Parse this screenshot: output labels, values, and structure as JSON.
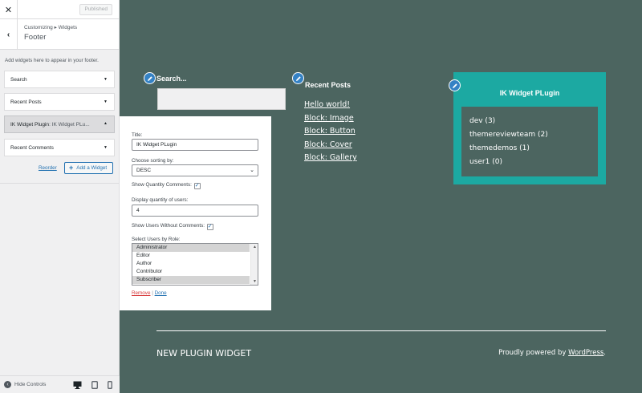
{
  "customizer": {
    "publish_label": "Published",
    "breadcrumb_parent": "Customizing",
    "breadcrumb_sep": "▸",
    "breadcrumb_child": "Widgets",
    "section_title": "Footer",
    "description": "Add widgets here to appear in your footer.",
    "widgets": [
      {
        "title": "Search",
        "subtitle": ""
      },
      {
        "title": "Recent Posts",
        "subtitle": ""
      },
      {
        "title": "IK Widget Plugin",
        "subtitle": ": IK Widget PLu..."
      },
      {
        "title": "Recent Comments",
        "subtitle": ""
      }
    ],
    "reorder_label": "Reorder",
    "add_widget_label": "Add a Widget",
    "hide_controls_label": "Hide Controls"
  },
  "widget_form": {
    "title_label": "Title:",
    "title_value": "IK Widget PLugin",
    "sorting_label": "Choose sorting by:",
    "sorting_value": "DESC",
    "show_comments_label": "Show Quantity Comments:",
    "quantity_label": "Display quantity of users:",
    "quantity_value": "4",
    "show_without_label": "Show Users Without Comments:",
    "roles_label": "Select Users by Role:",
    "roles": [
      "Administrator",
      "Editor",
      "Author",
      "Contributor",
      "Subscriber"
    ],
    "selected_roles": [
      "Administrator",
      "Subscriber"
    ],
    "remove_label": "Remove",
    "separator": " | ",
    "done_label": "Done"
  },
  "preview": {
    "search_title": "Search...",
    "recent_posts_title": "Recent Posts",
    "recent_posts": [
      "Hello world!",
      "Block: Image",
      "Block: Button",
      "Block: Cover",
      "Block: Gallery"
    ],
    "ik_widget_title": "IK Widget PLugin",
    "ik_items": [
      "dev (3)",
      "themereviewteam (2)",
      "themedemos (1)",
      "user1 (0)"
    ],
    "site_title": "NEW PLUGIN WIDGET",
    "powered_prefix": "Proudly powered by ",
    "powered_link": "WordPress",
    "powered_suffix": "."
  },
  "colors": {
    "site_background": "#4c6560",
    "ik_widget_background": "#1ca9a2",
    "link_blue": "#2271b1",
    "remove_red": "#d63638",
    "edit_pencil": "#3582c4"
  },
  "icons": [
    "close-icon",
    "back-arrow-icon",
    "chevron-down-icon",
    "plus-icon",
    "hide-controls-icon",
    "desktop-icon",
    "tablet-icon",
    "mobile-icon",
    "pencil-icon",
    "checkmark-icon"
  ]
}
